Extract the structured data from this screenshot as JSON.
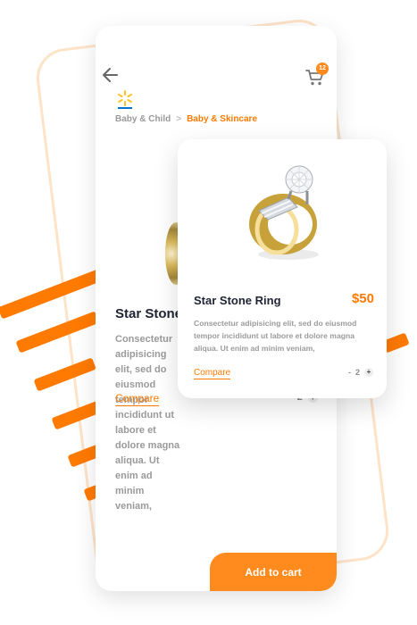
{
  "nav": {
    "back_icon": "arrow-left-icon",
    "cart_icon": "cart-icon",
    "cart_count": "12"
  },
  "store": {
    "logo": "walmart-logo"
  },
  "breadcrumb": {
    "items": [
      "Baby & Child",
      "Baby & Skincare"
    ],
    "separator": ">"
  },
  "product": {
    "title": "Star Stone Ring",
    "price": "$50",
    "description": "Consectetur adipisicing elit, sed do eiusmod tempor incididunt ut labore et dolore magna aliqua. Ut enim ad minim veniam,",
    "compare_label": "Compare",
    "quantity": "2",
    "decrease_label": "-",
    "increase_label": "+"
  },
  "actions": {
    "add_to_cart_label": "Add to cart"
  },
  "colors": {
    "accent": "#ff7a00",
    "title_text": "#1f2333",
    "muted_text": "#9a9a9a"
  }
}
